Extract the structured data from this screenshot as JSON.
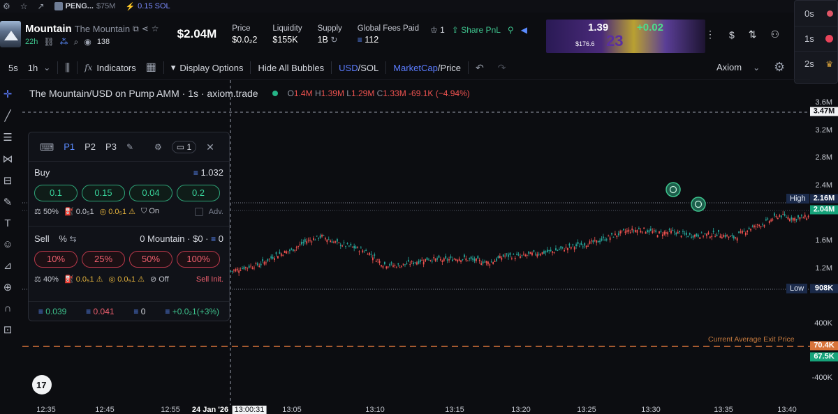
{
  "topstrip": {
    "pinned_ticker": "PENG...",
    "pinned_mcap": "$75M",
    "sol_amount": "0.15 SOL"
  },
  "token": {
    "ticker": "Mountain",
    "name": "The Mountain",
    "age": "22h",
    "viewers": "138",
    "market_cap": "$2.04M",
    "stats": [
      {
        "label": "Price",
        "value": "$0.0₂2"
      },
      {
        "label": "Liquidity",
        "value": "$155K"
      },
      {
        "label": "Supply",
        "value": "1B"
      },
      {
        "label": "Global Fees Paid",
        "value": "112"
      }
    ],
    "holders_count": "1",
    "share_pnl": "Share PnL"
  },
  "banner": {
    "value": "1.39",
    "delta": "+0.02",
    "sub": "$176.6",
    "jersey": "23"
  },
  "time_card": [
    {
      "label": "0s",
      "color": "#e05666"
    },
    {
      "label": "1s",
      "color": "#e8445a"
    },
    {
      "label": "2s",
      "color": "#d9a23a"
    }
  ],
  "toolbar": {
    "intervals": [
      "5s",
      "1h"
    ],
    "indicators": "Indicators",
    "display_options": "Display Options",
    "hide_bubbles": "Hide All Bubbles",
    "currency_active": "USD",
    "currency_alt": "/SOL",
    "mode_active": "MarketCap",
    "mode_alt": "/Price",
    "source": "Axiom"
  },
  "chart_title": {
    "text": "The Mountain/USD on Pump AMM · 1s · axiom.trade",
    "o": "1.4M",
    "h": "1.39M",
    "l": "1.29M",
    "c": "1.33M",
    "change": "-69.1K (−4.94%)"
  },
  "trade_panel": {
    "presets": [
      "P1",
      "P2",
      "P3"
    ],
    "wallet_count": "1",
    "buy": {
      "label": "Buy",
      "balance": "1.032",
      "amounts": [
        "0.1",
        "0.15",
        "0.04",
        "0.2"
      ],
      "slippage": "50%",
      "priority": "0.0₅1",
      "bribe": "0.0₅1",
      "mev": "On",
      "adv": "Adv."
    },
    "sell": {
      "label": "Sell",
      "unit": "%",
      "holding": "0 Mountain · $0 ·",
      "holding_sol": "0",
      "amounts": [
        "10%",
        "25%",
        "50%",
        "100%"
      ],
      "slippage": "40%",
      "priority": "0.0₅1",
      "bribe": "0.0₅1",
      "mev": "Off",
      "init": "Sell Init."
    },
    "footer": {
      "bought": "0.039",
      "sold": "0.041",
      "holding": "0",
      "pnl": "+0.0₂1(+3%)"
    }
  },
  "axis": {
    "price_ticks": [
      "3.6M",
      "3.2M",
      "2.8M",
      "2.4M",
      "1.6M",
      "1.2M",
      "400K",
      "-400K"
    ],
    "time_ticks": [
      "12:35",
      "12:45",
      "12:55",
      "24 Jan '26",
      "13:00:31",
      "13:05",
      "13:10",
      "13:15",
      "13:20",
      "13:25",
      "13:30",
      "13:35",
      "13:40"
    ],
    "tags": {
      "crosshair_price": "3.47M",
      "high": "2.16M",
      "last": "2.04M",
      "low": "908K",
      "avg_exit": "70.4K",
      "avg_entry": "67.5K"
    },
    "high_label": "High",
    "low_label": "Low",
    "avg_exit_label": "Current Average Exit Price"
  },
  "chart_data": {
    "type": "line",
    "title": "The Mountain/USD on Pump AMM · 1s · axiom.trade",
    "ylim": [
      -400000,
      3800000
    ],
    "series": [
      {
        "x": [
          "13:01",
          "13:03",
          "13:05",
          "13:06",
          "13:07",
          "13:08",
          "13:09",
          "13:10",
          "13:11",
          "13:12",
          "13:13",
          "13:14",
          "13:15",
          "13:16",
          "13:17",
          "13:18",
          "13:19",
          "13:20",
          "13:21",
          "13:22",
          "13:23",
          "13:24",
          "13:25",
          "13:26",
          "13:27",
          "13:28",
          "13:29",
          "13:30",
          "13:31",
          "13:32",
          "13:33",
          "13:34",
          "13:35",
          "13:36",
          "13:37",
          "13:38",
          "13:39",
          "13:40",
          "13:41"
        ],
        "values": [
          1330000,
          1380000,
          1420000,
          1540000,
          1600000,
          1720000,
          1780000,
          1690000,
          1640000,
          1580000,
          1420000,
          1400000,
          1440000,
          1490000,
          1470000,
          1500000,
          1470000,
          1440000,
          1530000,
          1520000,
          1560000,
          1580000,
          1630000,
          1670000,
          1710000,
          1780000,
          1850000,
          1870000,
          1820000,
          1840000,
          1790000,
          1800000,
          1810000,
          1760000,
          1880000,
          1950000,
          2050000,
          2010000,
          2040000
        ]
      }
    ]
  }
}
